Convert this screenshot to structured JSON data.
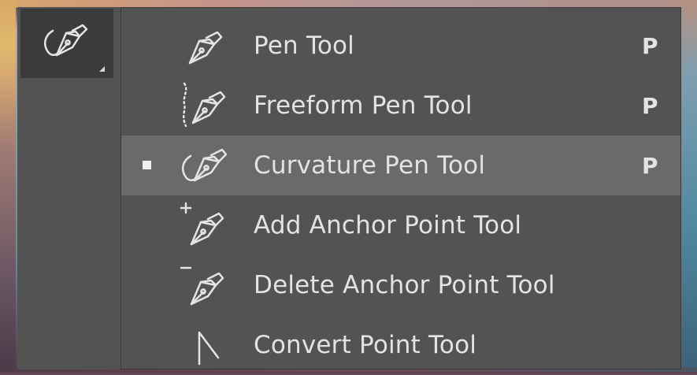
{
  "tool_group": {
    "icon": "curvature-pen-icon"
  },
  "menu": {
    "items": [
      {
        "label": "Pen Tool",
        "shortcut": "P",
        "icon": "pen-icon",
        "selected": false
      },
      {
        "label": "Freeform Pen Tool",
        "shortcut": "P",
        "icon": "freeform-pen-icon",
        "selected": false
      },
      {
        "label": "Curvature Pen Tool",
        "shortcut": "P",
        "icon": "curvature-pen-icon",
        "selected": true
      },
      {
        "label": "Add Anchor Point Tool",
        "shortcut": "",
        "icon": "add-anchor-point-icon",
        "selected": false
      },
      {
        "label": "Delete Anchor Point Tool",
        "shortcut": "",
        "icon": "delete-anchor-point-icon",
        "selected": false
      },
      {
        "label": "Convert Point Tool",
        "shortcut": "",
        "icon": "convert-point-icon",
        "selected": false
      }
    ]
  },
  "colors": {
    "panel_bg": "#535353",
    "active_row_bg": "#6a6a6a",
    "text": "#e3e3e3"
  }
}
